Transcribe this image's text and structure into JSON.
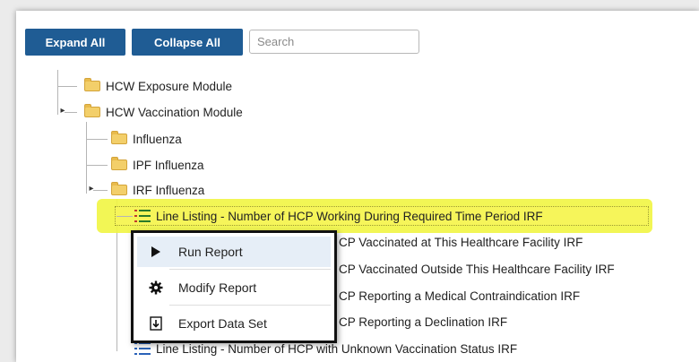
{
  "toolbar": {
    "expand_all_label": "Expand All",
    "collapse_all_label": "Collapse All",
    "search_placeholder": "Search"
  },
  "tree": {
    "hcw_exposure_label": "HCW Exposure Module",
    "hcw_vaccination_label": "HCW Vaccination Module",
    "influenza_label": "Influenza",
    "ipf_influenza_label": "IPF Influenza",
    "irf_influenza_label": "IRF Influenza",
    "reports": [
      {
        "label": "Line Listing - Number of HCP Working During Required Time Period IRF",
        "selected": true
      },
      {
        "label": "CP Vaccinated at This Healthcare Facility IRF"
      },
      {
        "label": "CP Vaccinated Outside This Healthcare Facility IRF"
      },
      {
        "label": "CP Reporting a Medical Contraindication IRF"
      },
      {
        "label": "CP Reporting a Declination IRF"
      },
      {
        "label": "Line Listing - Number of HCP with Unknown Vaccination Status IRF"
      }
    ]
  },
  "context_menu": {
    "items": [
      {
        "label": "Run Report",
        "icon": "play-icon"
      },
      {
        "label": "Modify Report",
        "icon": "gear-icon"
      },
      {
        "label": "Export Data Set",
        "icon": "export-icon"
      }
    ]
  },
  "colors": {
    "button_bg": "#1f5c94",
    "highlight": "#f1f542",
    "folder": "#f3cf6a"
  }
}
